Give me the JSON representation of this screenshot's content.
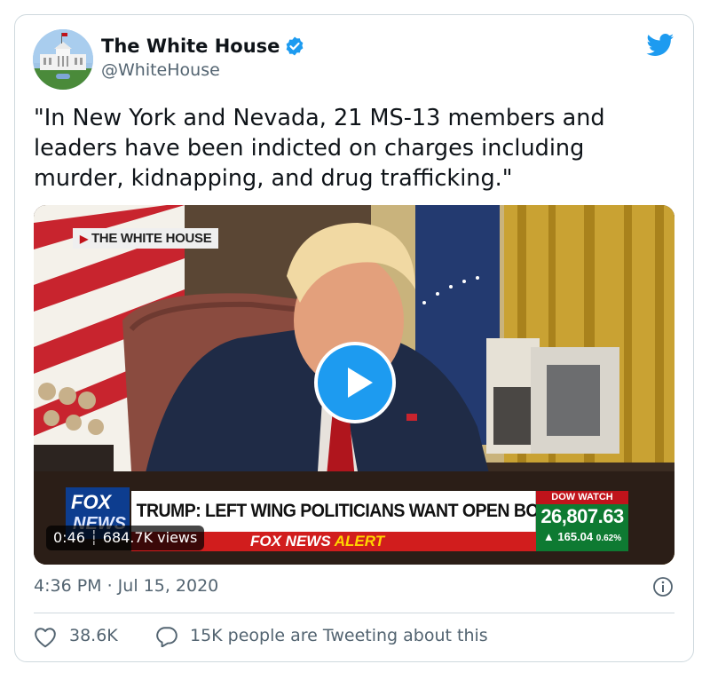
{
  "author": {
    "name": "The White House",
    "handle": "@WhiteHouse",
    "verified": true
  },
  "tweet": {
    "text": "\"In New York and Nevada, 21 MS-13 members and\nleaders have been indicted on charges including\nmurder, kidnapping, and drug trafficking.\""
  },
  "video": {
    "source_label": "THE WHITE HOUSE",
    "network": "FOX NEWS",
    "chyron": "TRUMP: LEFT WING POLITICIANS WANT OPEN BORDERS",
    "alert_prefix": "FOX NEWS",
    "alert_suffix": "ALERT",
    "ticker": {
      "header": "DOW WATCH",
      "value": "26,807.63",
      "change": "165.04",
      "change_pct": "0.62%"
    },
    "duration": "0:46",
    "views": "684.7K views",
    "play_icon": "play-icon"
  },
  "meta": {
    "timestamp": "4:36 PM · Jul 15, 2020"
  },
  "engagement": {
    "likes": "38.6K",
    "conversation": "15K people are Tweeting about this"
  },
  "colors": {
    "twitter_blue": "#1d9bf0",
    "secondary_text": "#536471",
    "border": "#cfd9de"
  }
}
